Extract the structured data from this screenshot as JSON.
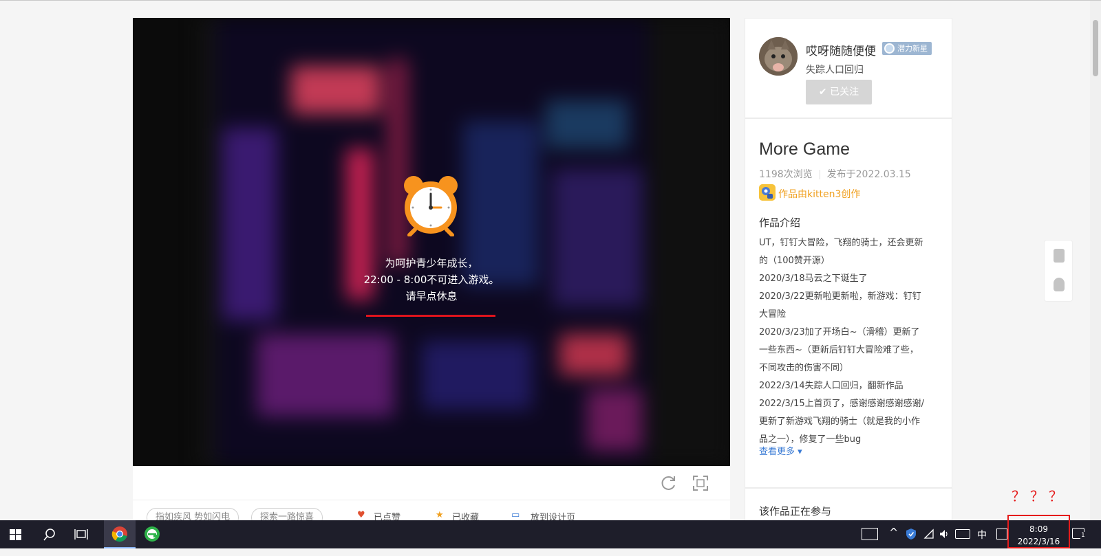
{
  "game": {
    "message_line1": "为呵护青少年成长，",
    "message_line2": "22:00 - 8:00不可进入游戏。",
    "message_line3": "请早点休息"
  },
  "tags": [
    "指如疾风 势如闪电",
    "探索一路惊喜"
  ],
  "actions": [
    "已点赞",
    "已收藏",
    "放到设计页"
  ],
  "author": {
    "name": "哎呀随随便便",
    "badge": "潜力新星",
    "subtitle": "失踪人口回归",
    "follow_label": "✔ 已关注"
  },
  "work": {
    "title": "More Game",
    "views": "1198次浏览",
    "published": "发布于2022.03.15",
    "made_with": "作品由kitten3创作",
    "intro_heading": "作品介绍",
    "intro_lines": [
      "UT，钉钉大冒险，飞翔的骑士，还会更新",
      "的（100赞开源）",
      "2020/3/18马云之下诞生了",
      "2020/3/22更新啦更新啦，新游戏：钉钉",
      "大冒险",
      "2020/3/23加了开场白~（滑稽）更新了",
      "一些东西~（更新后钉钉大冒险难了些，",
      "不同攻击的伤害不同）",
      "2022/3/14失踪人口回归，翻新作品",
      "2022/3/15上首页了，感谢感谢感谢感谢/",
      "更新了新游戏飞翔的骑士（就是我的小作",
      "品之一），修复了一些bug"
    ],
    "see_more": "查看更多 ▾",
    "participating": "该作品正在参与"
  },
  "annotation": {
    "qmarks": "？？？"
  },
  "taskbar": {
    "ime": "中",
    "time": "8:09",
    "date": "2022/3/16",
    "notification_count": "1"
  },
  "colors": {
    "accent_red": "#e51b1b",
    "link_blue": "#3a7bd5",
    "kitten_orange": "#f0a020"
  }
}
